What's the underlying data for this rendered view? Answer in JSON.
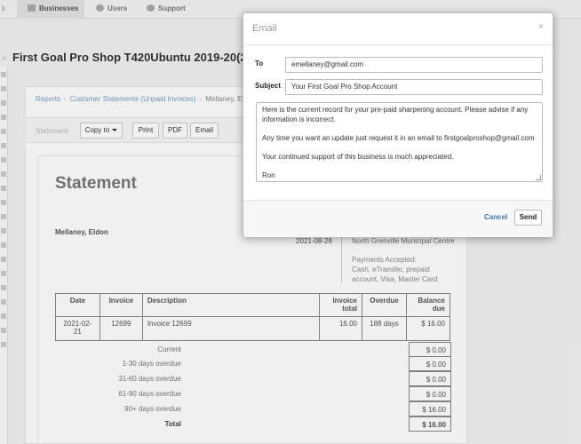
{
  "nav": {
    "tabs": [
      {
        "label": "Businesses",
        "icon": "building-icon"
      },
      {
        "label": "Users",
        "icon": "users-icon"
      },
      {
        "label": "Support",
        "icon": "support-icon"
      }
    ],
    "partial_tab": "k"
  },
  "page": {
    "close": "×",
    "title": "First Goal Pro Shop T420Ubuntu 2019-20(2019-04-"
  },
  "breadcrumb": {
    "items": [
      "Reports",
      "Customer Statements (Unpaid Invoices)",
      "Mellaney, Eldon -"
    ]
  },
  "toolbar": {
    "label": "Statement",
    "copy_to": "Copy to",
    "print": "Print",
    "pdf": "PDF",
    "email": "Email"
  },
  "statement": {
    "title": "Statement",
    "customer": "Mellaney, Eldon",
    "date": "2021-08-28",
    "organization": "North Grenville Municipal Centre",
    "payments_title": "Payments Accepted:",
    "payments_methods": "Cash, eTransfer, prepaid account, Visa, Master Card",
    "columns": [
      "Date",
      "Invoice",
      "Description",
      "Invoice total",
      "Overdue",
      "Balance due"
    ],
    "rows": [
      {
        "date": "2021-02-21",
        "invoice": "12699",
        "description": "Invoice 12699",
        "total": "16.00",
        "overdue": "188 days",
        "balance": "$ 16.00"
      }
    ],
    "totals": [
      {
        "label": "Current",
        "value": "$ 0.00"
      },
      {
        "label": "1-30 days overdue",
        "value": "$ 0.00"
      },
      {
        "label": "31-60 days overdue",
        "value": "$ 0.00"
      },
      {
        "label": "61-90 days overdue",
        "value": "$ 0.00"
      },
      {
        "label": "90+ days overdue",
        "value": "$ 16.00"
      },
      {
        "label": "Total",
        "value": "$ 16.00"
      }
    ]
  },
  "email_modal": {
    "title": "Email",
    "close": "×",
    "to_label": "To",
    "to_value": "emellaney@gmail.com",
    "subject_label": "Subject",
    "subject_value": "Your First Goal Pro Shop Account",
    "body_lines": [
      "Here is the current record for your pre-paid sharpening account. Please advise if any information is incorrect.",
      "Any time you want an update just request it in an email to firstgoalproshop@gmail.com",
      "Your continued support of this business is much appreciated.",
      "Ron"
    ],
    "cancel": "Cancel",
    "send": "Send"
  }
}
